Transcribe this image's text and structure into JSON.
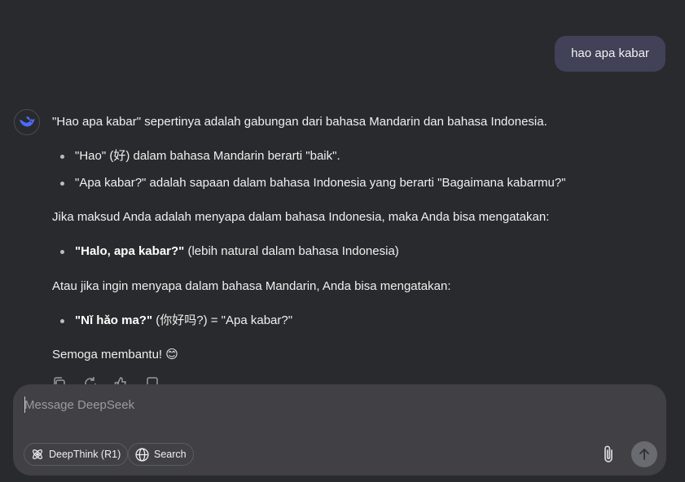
{
  "user_message": "hao apa kabar",
  "answer": {
    "intro": "\"Hao apa kabar\" sepertinya adalah gabungan dari bahasa Mandarin dan bahasa Indonesia.",
    "list1": [
      "\"Hao\" (好) dalam bahasa Mandarin berarti \"baik\".",
      "\"Apa kabar?\" adalah sapaan dalam bahasa Indonesia yang berarti \"Bagaimana kabarmu?\""
    ],
    "para2": "Jika maksud Anda adalah menyapa dalam bahasa Indonesia, maka Anda bisa mengatakan:",
    "item2_bold": "\"Halo, apa kabar?\"",
    "item2_rest": " (lebih natural dalam bahasa Indonesia)",
    "para3": "Atau jika ingin menyapa dalam bahasa Mandarin, Anda bisa mengatakan:",
    "item3_bold": "\"Nǐ hǎo ma?\"",
    "item3_rest": " (你好吗?) = \"Apa kabar?\"",
    "closing": "Semoga membantu! 😊"
  },
  "composer": {
    "placeholder": "Message DeepSeek",
    "deepthink_label": "DeepThink (R1)",
    "search_label": "Search"
  },
  "icons": {
    "avatar": "deepseek-whale-icon",
    "actions": [
      "copy-icon",
      "regenerate-icon",
      "thumbs-up-icon",
      "thumbs-down-icon"
    ],
    "deepthink": "atom-icon",
    "search": "globe-icon",
    "attach": "paperclip-icon",
    "send": "arrow-up-icon"
  },
  "colors": {
    "background": "#292a2d",
    "user_bubble": "#414158",
    "composer": "#404045",
    "accent": "#4d6bfe"
  }
}
